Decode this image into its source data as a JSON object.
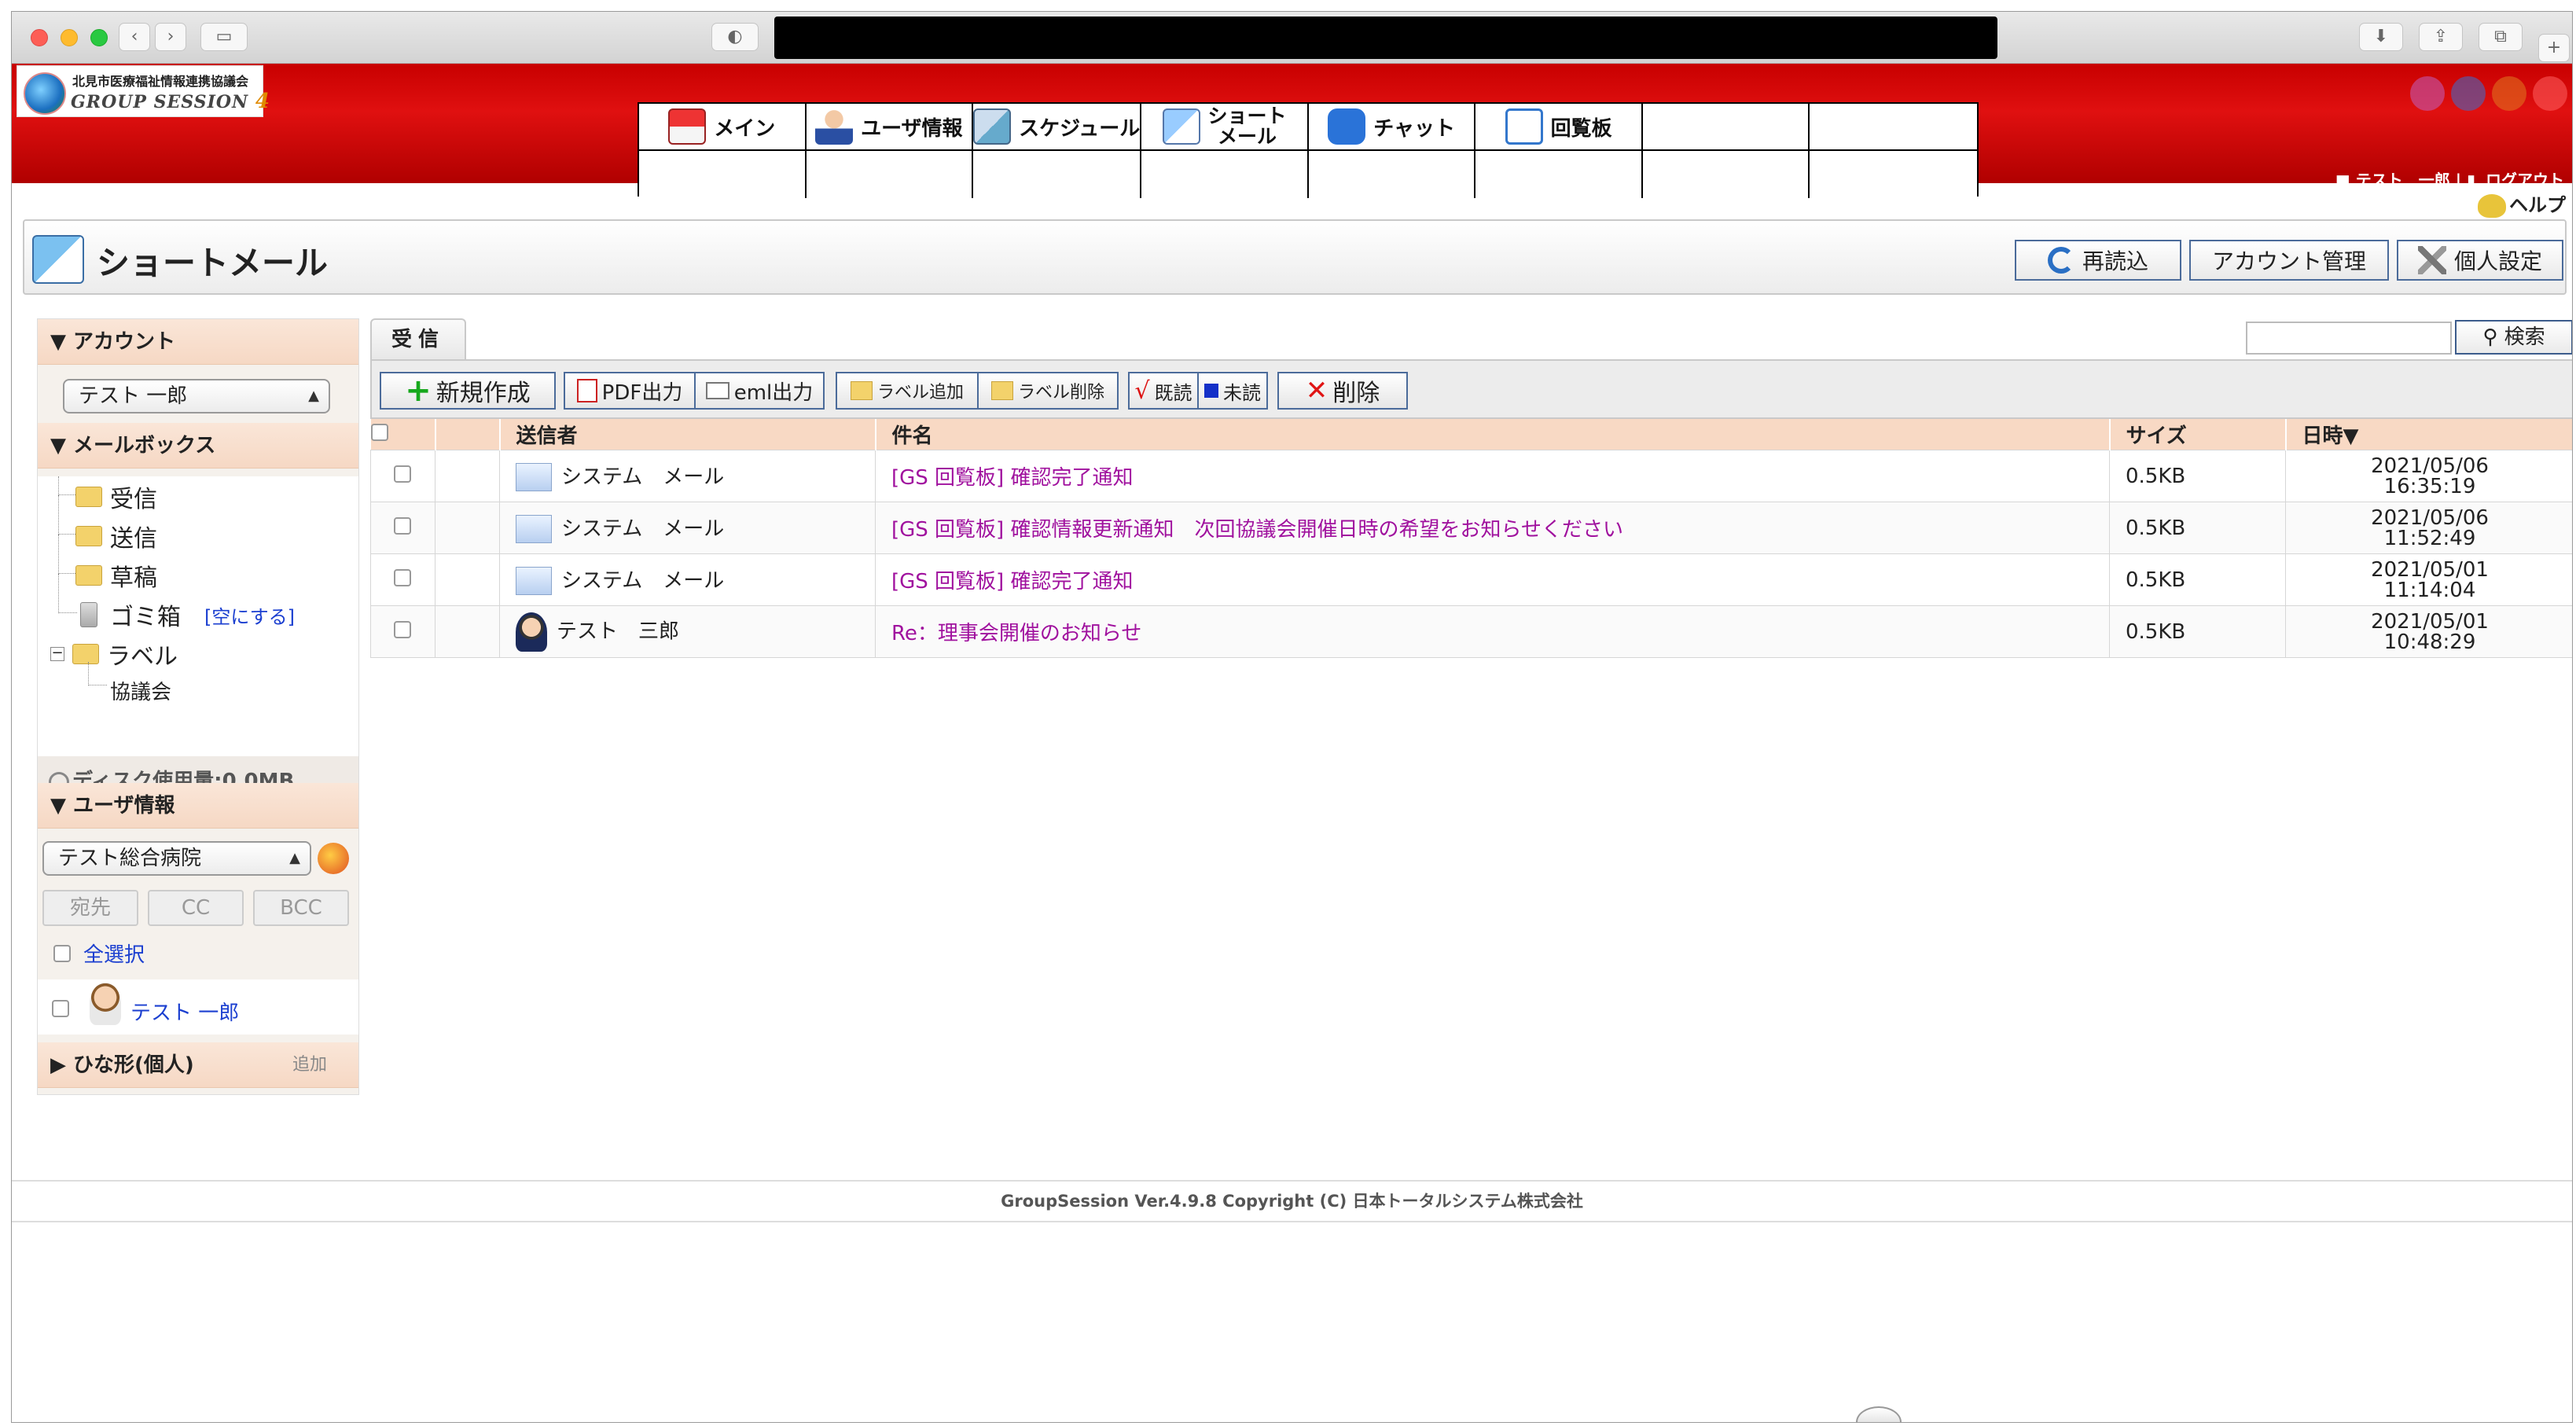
{
  "header": {
    "org_name": "北見市医療福祉情報連携協議会",
    "product_name": "GROUP SESSION",
    "product_version_mark": "4",
    "menu": [
      {
        "label": "メイン",
        "icon": "house-icon"
      },
      {
        "label": "ユーザ情報",
        "icon": "user-icon"
      },
      {
        "label": "スケジュール",
        "icon": "schedule-icon"
      },
      {
        "label": "ショート\nメール",
        "icon": "shortmail-icon"
      },
      {
        "label": "チャット",
        "icon": "chat-icon"
      },
      {
        "label": "回覧板",
        "icon": "clipboard-icon"
      }
    ],
    "user_name": "テスト　一郎",
    "separator": "|",
    "logout": "ログアウト",
    "help": "ヘルプ"
  },
  "page": {
    "title": "ショートメール",
    "buttons": {
      "reload": "再読込",
      "account_manage": "アカウント管理",
      "personal_settings": "個人設定"
    }
  },
  "sidebar": {
    "account_head": "アカウント",
    "account_select": "テスト 一郎",
    "mailbox_head": "メールボックス",
    "folders": {
      "inbox": "受信",
      "sent": "送信",
      "draft": "草稿",
      "trash": "ゴミ箱",
      "trash_empty": "[空にする]",
      "label": "ラベル",
      "sublabel": "協議会"
    },
    "disk_usage": "ディスク使用量:0.0MB",
    "user_head": "ユーザ情報",
    "group_select": "テスト総合病院",
    "to_tab": "宛先",
    "cc_tab": "CC",
    "bcc_tab": "BCC",
    "select_all": "全選択",
    "user": "テスト 一郎",
    "template_head": "ひな形(個人)",
    "template_add": "追加"
  },
  "main": {
    "tab": "受信",
    "search_button": "検索",
    "search_value": "",
    "toolbar": {
      "new": "新規作成",
      "pdf": "PDF出力",
      "eml": "eml出力",
      "label_add": "ラベル追加",
      "label_del": "ラベル削除",
      "read": "既読",
      "unread": "未読",
      "delete": "削除"
    },
    "columns": {
      "sender": "送信者",
      "subject": "件名",
      "size": "サイズ",
      "date": "日時▼"
    },
    "rows": [
      {
        "sender": "システム　メール",
        "subject": "[GS 回覧板] 確認完了通知",
        "size": "0.5KB",
        "date": "2021/05/06",
        "time": "16:35:19"
      },
      {
        "sender": "システム　メール",
        "subject": "[GS 回覧板] 確認情報更新通知　次回協議会開催日時の希望をお知らせください",
        "size": "0.5KB",
        "date": "2021/05/06",
        "time": "11:52:49"
      },
      {
        "sender": "システム　メール",
        "subject": "[GS 回覧板] 確認完了通知",
        "size": "0.5KB",
        "date": "2021/05/01",
        "time": "11:14:04"
      },
      {
        "sender": "テスト　三郎",
        "subject": "Re：理事会開催のお知らせ",
        "size": "0.5KB",
        "date": "2021/05/01",
        "time": "10:48:29"
      }
    ]
  },
  "footer": "GroupSession Ver.4.9.8 Copyright (C) 日本トータルシステム株式会社",
  "colors": {
    "header_red": "#d00000",
    "sidebar_head": "#f6d8c4",
    "subject_link": "#a0119e",
    "link_blue": "#1b3fd0",
    "button_border": "#4b6b9a"
  }
}
